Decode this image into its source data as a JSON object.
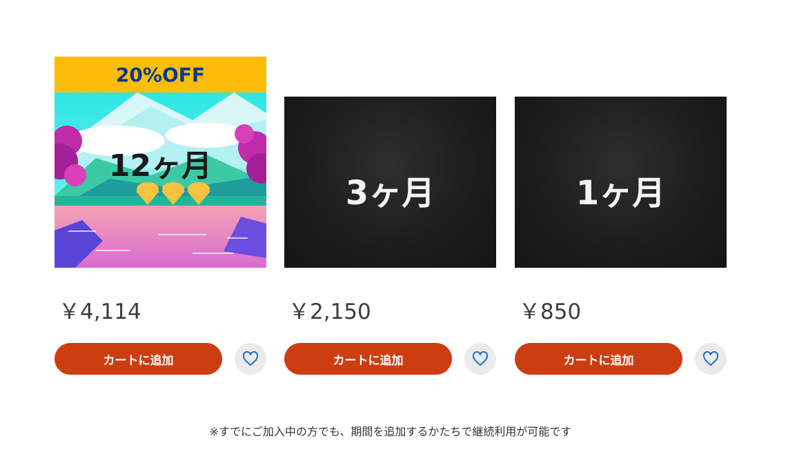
{
  "products": [
    {
      "badge": "20%OFF",
      "label": "12ヶ月",
      "price": "￥4,114",
      "cart_label": "カートに追加",
      "wishlist_icon": "heart-outline-icon"
    },
    {
      "label": "3ヶ月",
      "price": "￥2,150",
      "cart_label": "カートに追加",
      "wishlist_icon": "heart-outline-icon"
    },
    {
      "label": "1ヶ月",
      "price": "￥850",
      "cart_label": "カートに追加",
      "wishlist_icon": "heart-outline-icon"
    }
  ],
  "note": "※すでにご加入中の方でも、期間を追加するかたちで継続利用が可能です",
  "colors": {
    "badge_bg": "#fbbd08",
    "badge_text": "#0b3a8c",
    "cart_button": "#cd3d12",
    "fav_button_bg": "#ebebeb",
    "heart": "#1a6fc9",
    "dark_tile": "#1c1c1c"
  }
}
